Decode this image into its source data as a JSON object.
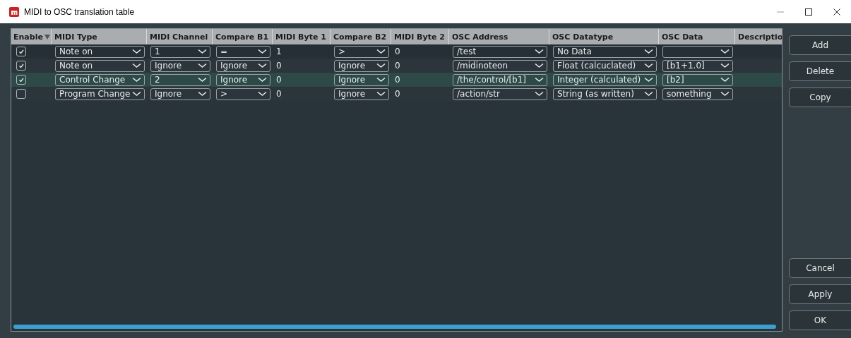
{
  "window": {
    "title": "MIDI to OSC translation table"
  },
  "table": {
    "columns": [
      {
        "label": "Enable",
        "sorted": true
      },
      {
        "label": "MIDI Type"
      },
      {
        "label": "MIDI Channel"
      },
      {
        "label": "Compare B1"
      },
      {
        "label": "MIDI Byte 1"
      },
      {
        "label": "Compare B2"
      },
      {
        "label": "MIDI Byte 2"
      },
      {
        "label": "OSC Address"
      },
      {
        "label": "OSC Datatype"
      },
      {
        "label": "OSC Data"
      },
      {
        "label": "Descriptio"
      }
    ],
    "rows": [
      {
        "selected": false,
        "cells": [
          {
            "kind": "checkbox",
            "checked": true
          },
          {
            "kind": "combo",
            "value": "Note on"
          },
          {
            "kind": "combo",
            "value": "1"
          },
          {
            "kind": "combo",
            "value": "="
          },
          {
            "kind": "text",
            "value": "1"
          },
          {
            "kind": "combo",
            "value": ">"
          },
          {
            "kind": "text",
            "value": "0"
          },
          {
            "kind": "combo",
            "value": "/test"
          },
          {
            "kind": "combo",
            "value": "No Data"
          },
          {
            "kind": "combo"
          }
        ]
      },
      {
        "selected": false,
        "cells": [
          {
            "kind": "checkbox",
            "checked": true
          },
          {
            "kind": "combo",
            "value": "Note on"
          },
          {
            "kind": "combo",
            "value": "Ignore"
          },
          {
            "kind": "combo",
            "value": "Ignore"
          },
          {
            "kind": "text",
            "value": "0"
          },
          {
            "kind": "combo",
            "value": "Ignore"
          },
          {
            "kind": "text",
            "value": "0"
          },
          {
            "kind": "combo",
            "value": "/midinoteon"
          },
          {
            "kind": "combo",
            "value": "Float (calcuclated)"
          },
          {
            "kind": "combo",
            "value": "[b1+1.0]"
          }
        ]
      },
      {
        "selected": true,
        "cells": [
          {
            "kind": "checkbox",
            "checked": true
          },
          {
            "kind": "combo",
            "value": "Control Change"
          },
          {
            "kind": "combo",
            "value": "2"
          },
          {
            "kind": "combo",
            "value": "Ignore"
          },
          {
            "kind": "text",
            "value": "0"
          },
          {
            "kind": "combo",
            "value": "Ignore"
          },
          {
            "kind": "text",
            "value": "0"
          },
          {
            "kind": "combo",
            "value": "/the/control/[b1]"
          },
          {
            "kind": "combo",
            "value": "Integer (calculated)"
          },
          {
            "kind": "combo",
            "value": "[b2]"
          }
        ]
      },
      {
        "selected": false,
        "cells": [
          {
            "kind": "checkbox",
            "checked": false
          },
          {
            "kind": "combo",
            "value": "Program Change"
          },
          {
            "kind": "combo",
            "value": "Ignore"
          },
          {
            "kind": "combo",
            "value": ">"
          },
          {
            "kind": "text",
            "value": "0"
          },
          {
            "kind": "combo",
            "value": "Ignore"
          },
          {
            "kind": "text",
            "value": "0"
          },
          {
            "kind": "combo",
            "value": "/action/str"
          },
          {
            "kind": "combo",
            "value": "String (as written)"
          },
          {
            "kind": "combo",
            "value": "something"
          }
        ]
      }
    ]
  },
  "buttons": {
    "top": [
      "Add",
      "Delete",
      "Copy"
    ],
    "bottom": [
      "Cancel",
      "Apply",
      "OK"
    ]
  }
}
